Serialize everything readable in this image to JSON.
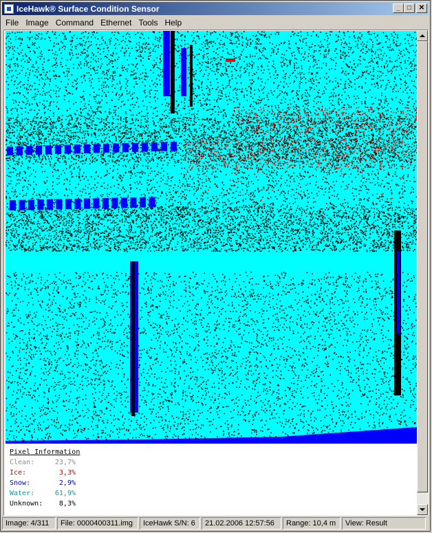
{
  "window": {
    "title": "IceHawk® Surface Condition Sensor",
    "controls": {
      "minimize": "_",
      "maximize": "□",
      "close": "✕"
    }
  },
  "menu": {
    "items": [
      {
        "label": "File"
      },
      {
        "label": "Image"
      },
      {
        "label": "Command"
      },
      {
        "label": "Ethernet"
      },
      {
        "label": "Tools"
      },
      {
        "label": "Help"
      }
    ]
  },
  "pixel_info": {
    "title": "Pixel Information",
    "rows": [
      {
        "label": "Clean:",
        "value": "23,7%",
        "color": "#8c8c8c"
      },
      {
        "label": "Ice:",
        "value": "3,3%",
        "color": "#d00000"
      },
      {
        "label": "Snow:",
        "value": "2,9%",
        "color": "#0000c0"
      },
      {
        "label": "Water:",
        "value": "61,9%",
        "color": "#00a0a0"
      },
      {
        "label": "Unknown:",
        "value": "8,3%",
        "color": "#000000"
      }
    ]
  },
  "status": {
    "image": "Image: 4/311",
    "file": "File: 0000400311.img",
    "serial": "IceHawk S/N: 6",
    "datetime": "21.02.2006 12:57:56",
    "range": "Range: 10,4 m",
    "view": "View: Result"
  },
  "colors": {
    "water": "#00ffff",
    "ice": "#ff0000",
    "snow": "#0000ff",
    "unknown": "#000000",
    "clean": "#808080"
  }
}
